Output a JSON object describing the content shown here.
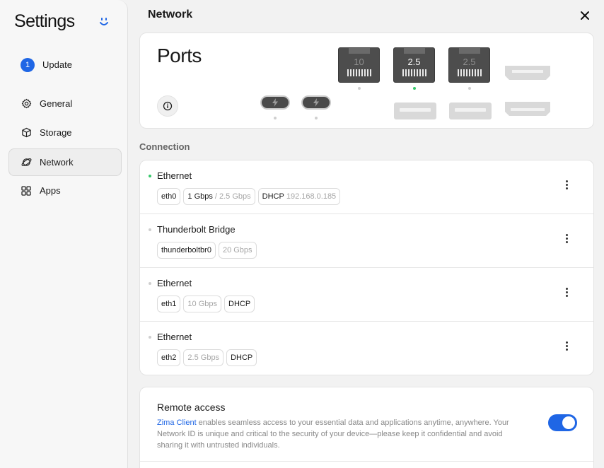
{
  "app": {
    "title": "Settings"
  },
  "sidebar": {
    "update": {
      "badge": "1",
      "label": "Update"
    },
    "items": [
      {
        "id": "general",
        "label": "General",
        "icon": "gear-icon"
      },
      {
        "id": "storage",
        "label": "Storage",
        "icon": "cube-icon"
      },
      {
        "id": "network",
        "label": "Network",
        "icon": "planet-icon",
        "active": true
      },
      {
        "id": "apps",
        "label": "Apps",
        "icon": "grid-icon"
      }
    ]
  },
  "header": {
    "title": "Network"
  },
  "ports": {
    "title": "Ports",
    "ethernet": [
      {
        "speed": "10",
        "active": false
      },
      {
        "speed": "2.5",
        "active": true
      },
      {
        "speed": "2.5",
        "active": false
      }
    ]
  },
  "connection": {
    "label": "Connection",
    "rows": [
      {
        "name": "Ethernet",
        "active": true,
        "iface": "eth0",
        "speed": "1 Gbps",
        "max": "/ 2.5 Gbps",
        "dhcp": "DHCP",
        "ip": "192.168.0.185"
      },
      {
        "name": "Thunderbolt Bridge",
        "active": false,
        "iface": "thunderboltbr0",
        "speed": "20 Gbps"
      },
      {
        "name": "Ethernet",
        "active": false,
        "iface": "eth1",
        "speed": "10 Gbps",
        "dhcp": "DHCP"
      },
      {
        "name": "Ethernet",
        "active": false,
        "iface": "eth2",
        "speed": "2.5 Gbps",
        "dhcp": "DHCP"
      }
    ]
  },
  "remote": {
    "title": "Remote access",
    "link": "Zima Client",
    "description": " enables seamless access to your essential data and applications anytime, anywhere. Your Network ID is unique and critical to the security of your device—please keep it confidential and avoid sharing it with untrusted individuals.",
    "enabled": true
  },
  "colors": {
    "accent": "#1f66e5",
    "active_dot": "#37c86b"
  }
}
